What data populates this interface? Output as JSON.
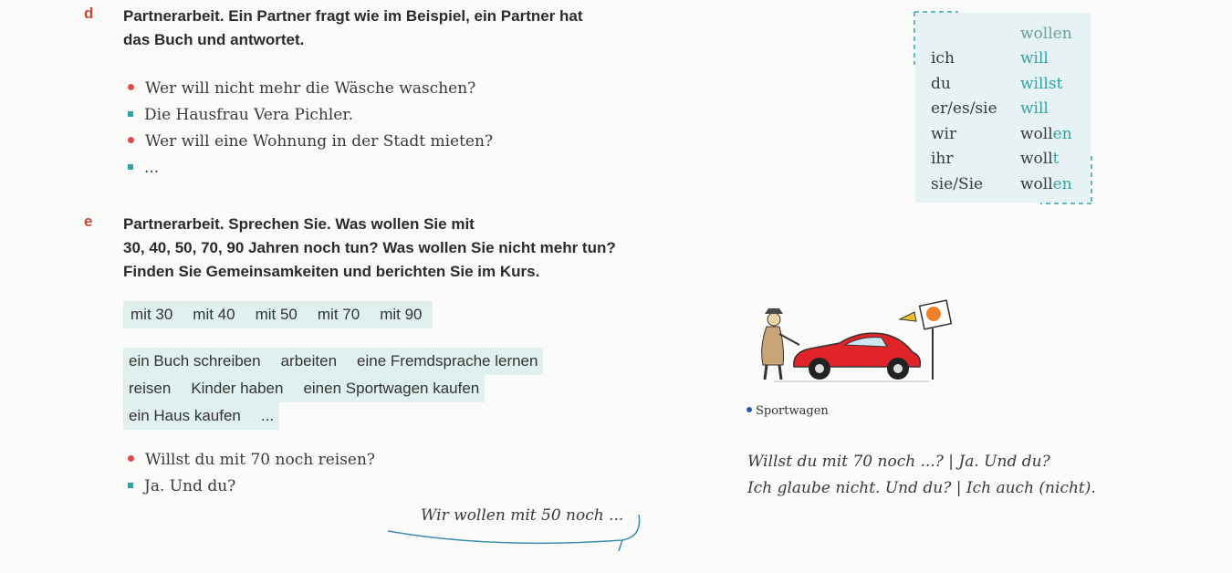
{
  "d": {
    "letter": "d",
    "instruction_line1": "Partnerarbeit. Ein Partner fragt wie im Beispiel, ein Partner hat",
    "instruction_line2": "das Buch und antwortet.",
    "dialog": [
      {
        "marker": "dot",
        "text": "Wer will nicht mehr die Wäsche waschen?"
      },
      {
        "marker": "square",
        "text": "Die Hausfrau Vera Pichler."
      },
      {
        "marker": "dot",
        "text": "Wer will eine Wohnung in der Stadt mieten?"
      },
      {
        "marker": "square",
        "text": "..."
      }
    ]
  },
  "grammar": {
    "header": "wollen",
    "rows": [
      {
        "pronoun": "ich",
        "stem": "",
        "ending": "will"
      },
      {
        "pronoun": "du",
        "stem": "",
        "ending": "willst"
      },
      {
        "pronoun": "er/es/sie",
        "stem": "",
        "ending": "will"
      },
      {
        "pronoun": "wir",
        "stem": "woll",
        "ending": "en"
      },
      {
        "pronoun": "ihr",
        "stem": "woll",
        "ending": "t"
      },
      {
        "pronoun": "sie/Sie",
        "stem": "woll",
        "ending": "en"
      }
    ]
  },
  "e": {
    "letter": "e",
    "instruction_line1": "Partnerarbeit. Sprechen Sie. Was wollen Sie mit",
    "instruction_line2": "30, 40, 50, 70, 90 Jahren noch tun? Was wollen Sie nicht mehr tun?",
    "instruction_line3": "Finden Sie Gemeinsamkeiten und berichten Sie im Kurs.",
    "ages": [
      "mit 30",
      "mit 40",
      "mit 50",
      "mit 70",
      "mit 90"
    ],
    "activities": [
      [
        "ein Buch schreiben",
        "arbeiten",
        "eine Fremdsprache lernen"
      ],
      [
        "reisen",
        "Kinder haben",
        "einen Sportwagen kaufen"
      ],
      [
        "ein Haus kaufen",
        "..."
      ]
    ],
    "dialog": [
      {
        "marker": "dot",
        "text": "Willst du mit 70 noch reisen?"
      },
      {
        "marker": "square",
        "text": "Ja. Und du?"
      }
    ],
    "speech_bubble": "Wir wollen mit 50 noch ...",
    "hints": [
      "Willst du mit 70 noch ...? | Ja. Und du?",
      "Ich glaube nicht. Und du? | Ich auch (nicht)."
    ]
  },
  "illustration": {
    "caption": "Sportwagen",
    "car_color": "#e0242a"
  }
}
